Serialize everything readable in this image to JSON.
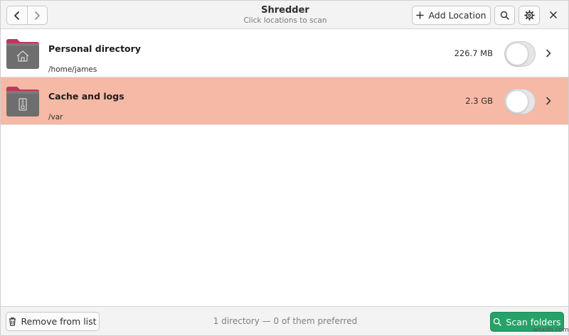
{
  "header": {
    "title": "Shredder",
    "subtitle": "Click locations to scan",
    "back_icon": "chevron-left-icon",
    "forward_icon": "chevron-right-icon",
    "add_location_label": "Add Location",
    "add_icon": "plus-icon",
    "search_icon": "search-icon",
    "settings_icon": "gear-icon",
    "close_icon": "close-icon"
  },
  "locations": [
    {
      "name": "Personal directory",
      "path": "/home/james",
      "size": "226.7 MB",
      "icon": "home-folder-icon",
      "enabled": false,
      "selected": false
    },
    {
      "name": "Cache and logs",
      "path": "/var",
      "size": "2.3 GB",
      "icon": "archive-folder-icon",
      "enabled": false,
      "selected": true
    }
  ],
  "footer": {
    "remove_label": "Remove from list",
    "remove_icon": "trash-icon",
    "status": "1 directory — 0 of them preferred",
    "scan_label": "Scan folders",
    "scan_icon": "search-icon"
  },
  "watermark": "wsxdn.com",
  "colors": {
    "selected_row": "#f5b9a5",
    "scan_button": "#26a269",
    "folder_tab": "#c0365c",
    "folder_body": "#6e6e6e"
  }
}
